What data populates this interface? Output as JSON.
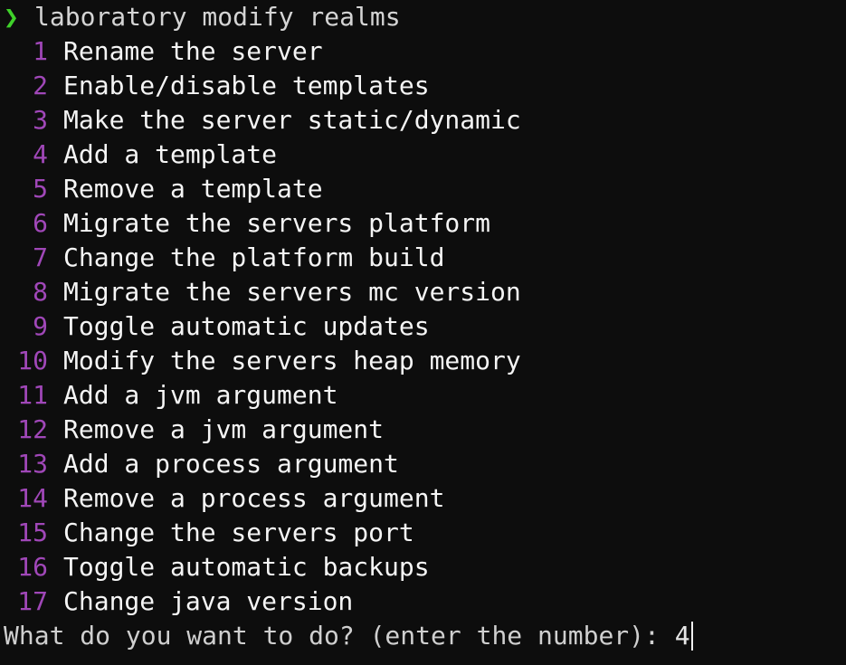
{
  "command": {
    "prompt_glyph": "❯",
    "text": "laboratory modify realms"
  },
  "menu": {
    "options": [
      {
        "num": "1",
        "label": "Rename the server"
      },
      {
        "num": "2",
        "label": "Enable/disable templates"
      },
      {
        "num": "3",
        "label": "Make the server static/dynamic"
      },
      {
        "num": "4",
        "label": "Add a template"
      },
      {
        "num": "5",
        "label": "Remove a template"
      },
      {
        "num": "6",
        "label": "Migrate the servers platform"
      },
      {
        "num": "7",
        "label": "Change the platform build"
      },
      {
        "num": "8",
        "label": "Migrate the servers mc version"
      },
      {
        "num": "9",
        "label": "Toggle automatic updates"
      },
      {
        "num": "10",
        "label": "Modify the servers heap memory"
      },
      {
        "num": "11",
        "label": "Add a jvm argument"
      },
      {
        "num": "12",
        "label": "Remove a jvm argument"
      },
      {
        "num": "13",
        "label": "Add a process argument"
      },
      {
        "num": "14",
        "label": "Remove a process argument"
      },
      {
        "num": "15",
        "label": "Change the servers port"
      },
      {
        "num": "16",
        "label": "Toggle automatic backups"
      },
      {
        "num": "17",
        "label": "Change java version"
      }
    ]
  },
  "input": {
    "question": "What do you want to do? (enter the number): ",
    "value": "4"
  },
  "colors": {
    "background": "#0d0d0d",
    "prompt_glyph": "#3fd12a",
    "option_number": "#a047b8",
    "text": "#f5f5f5"
  }
}
